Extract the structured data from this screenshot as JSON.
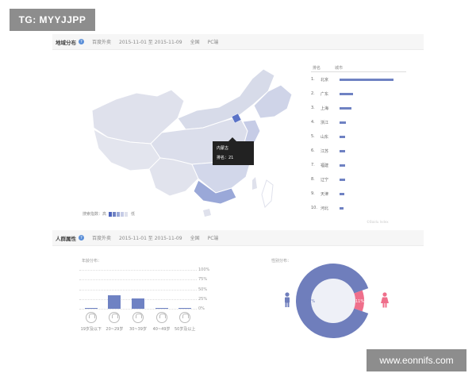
{
  "watermarks": {
    "top_left": "TG: MYYJJPP",
    "bottom_right": "www.eonnifs.com"
  },
  "region_panel": {
    "title": "地域分布",
    "help_icon": "?",
    "filter_source": "百度外卖",
    "date_range": "2015-11-01 至 2015-11-09",
    "scope": "全国",
    "device": "PC端",
    "tooltip": {
      "region": "内蒙古",
      "rank_text": "排名：21"
    },
    "legend": {
      "low": "搜索指数：高",
      "high": "低"
    },
    "rank_header": {
      "col1": "排名",
      "col2": "城市"
    },
    "ranking": [
      {
        "rank": "1.",
        "city": "北京",
        "share": 1.0
      },
      {
        "rank": "2.",
        "city": "广东",
        "share": 0.25
      },
      {
        "rank": "3.",
        "city": "上海",
        "share": 0.22
      },
      {
        "rank": "4.",
        "city": "浙江",
        "share": 0.12
      },
      {
        "rank": "5.",
        "city": "山东",
        "share": 0.11
      },
      {
        "rank": "6.",
        "city": "江苏",
        "share": 0.11
      },
      {
        "rank": "7.",
        "city": "福建",
        "share": 0.1
      },
      {
        "rank": "8.",
        "city": "辽宁",
        "share": 0.1
      },
      {
        "rank": "9.",
        "city": "天津",
        "share": 0.09
      },
      {
        "rank": "10.",
        "city": "河北",
        "share": 0.08
      }
    ],
    "copyright": "©Baidu Index"
  },
  "crowd_panel": {
    "title": "人群属性",
    "help_icon": "?",
    "filter_source": "百度外卖",
    "date_range": "2015-11-01 至 2015-11-09",
    "scope": "全国",
    "device": "PC端",
    "age_title": "年龄分布：",
    "gender_title": "性别分布：",
    "axis_ticks": [
      "100%",
      "75%",
      "50%",
      "25%",
      "0%"
    ],
    "female_label": "11%",
    "male_label": "89%"
  },
  "chart_data": [
    {
      "type": "bar",
      "title": "年龄分布：",
      "categories": [
        "19岁及以下",
        "20~29岁",
        "30~39岁",
        "40~49岁",
        "50岁及以上"
      ],
      "values": [
        1,
        34,
        26,
        2,
        1
      ],
      "ylim": [
        0,
        100
      ],
      "ylabel": "",
      "xlabel": "",
      "color": "#6f82c3"
    },
    {
      "type": "pie",
      "title": "性别分布：",
      "categories": [
        "男",
        "女"
      ],
      "values": [
        89,
        11
      ],
      "colors": [
        "#6f7ebc",
        "#ef6f8b"
      ]
    }
  ],
  "colors": {
    "accent": "#6f82c3",
    "female": "#ef6f8b",
    "male": "#6f7ebc",
    "map_base": "#dfe1ec"
  }
}
